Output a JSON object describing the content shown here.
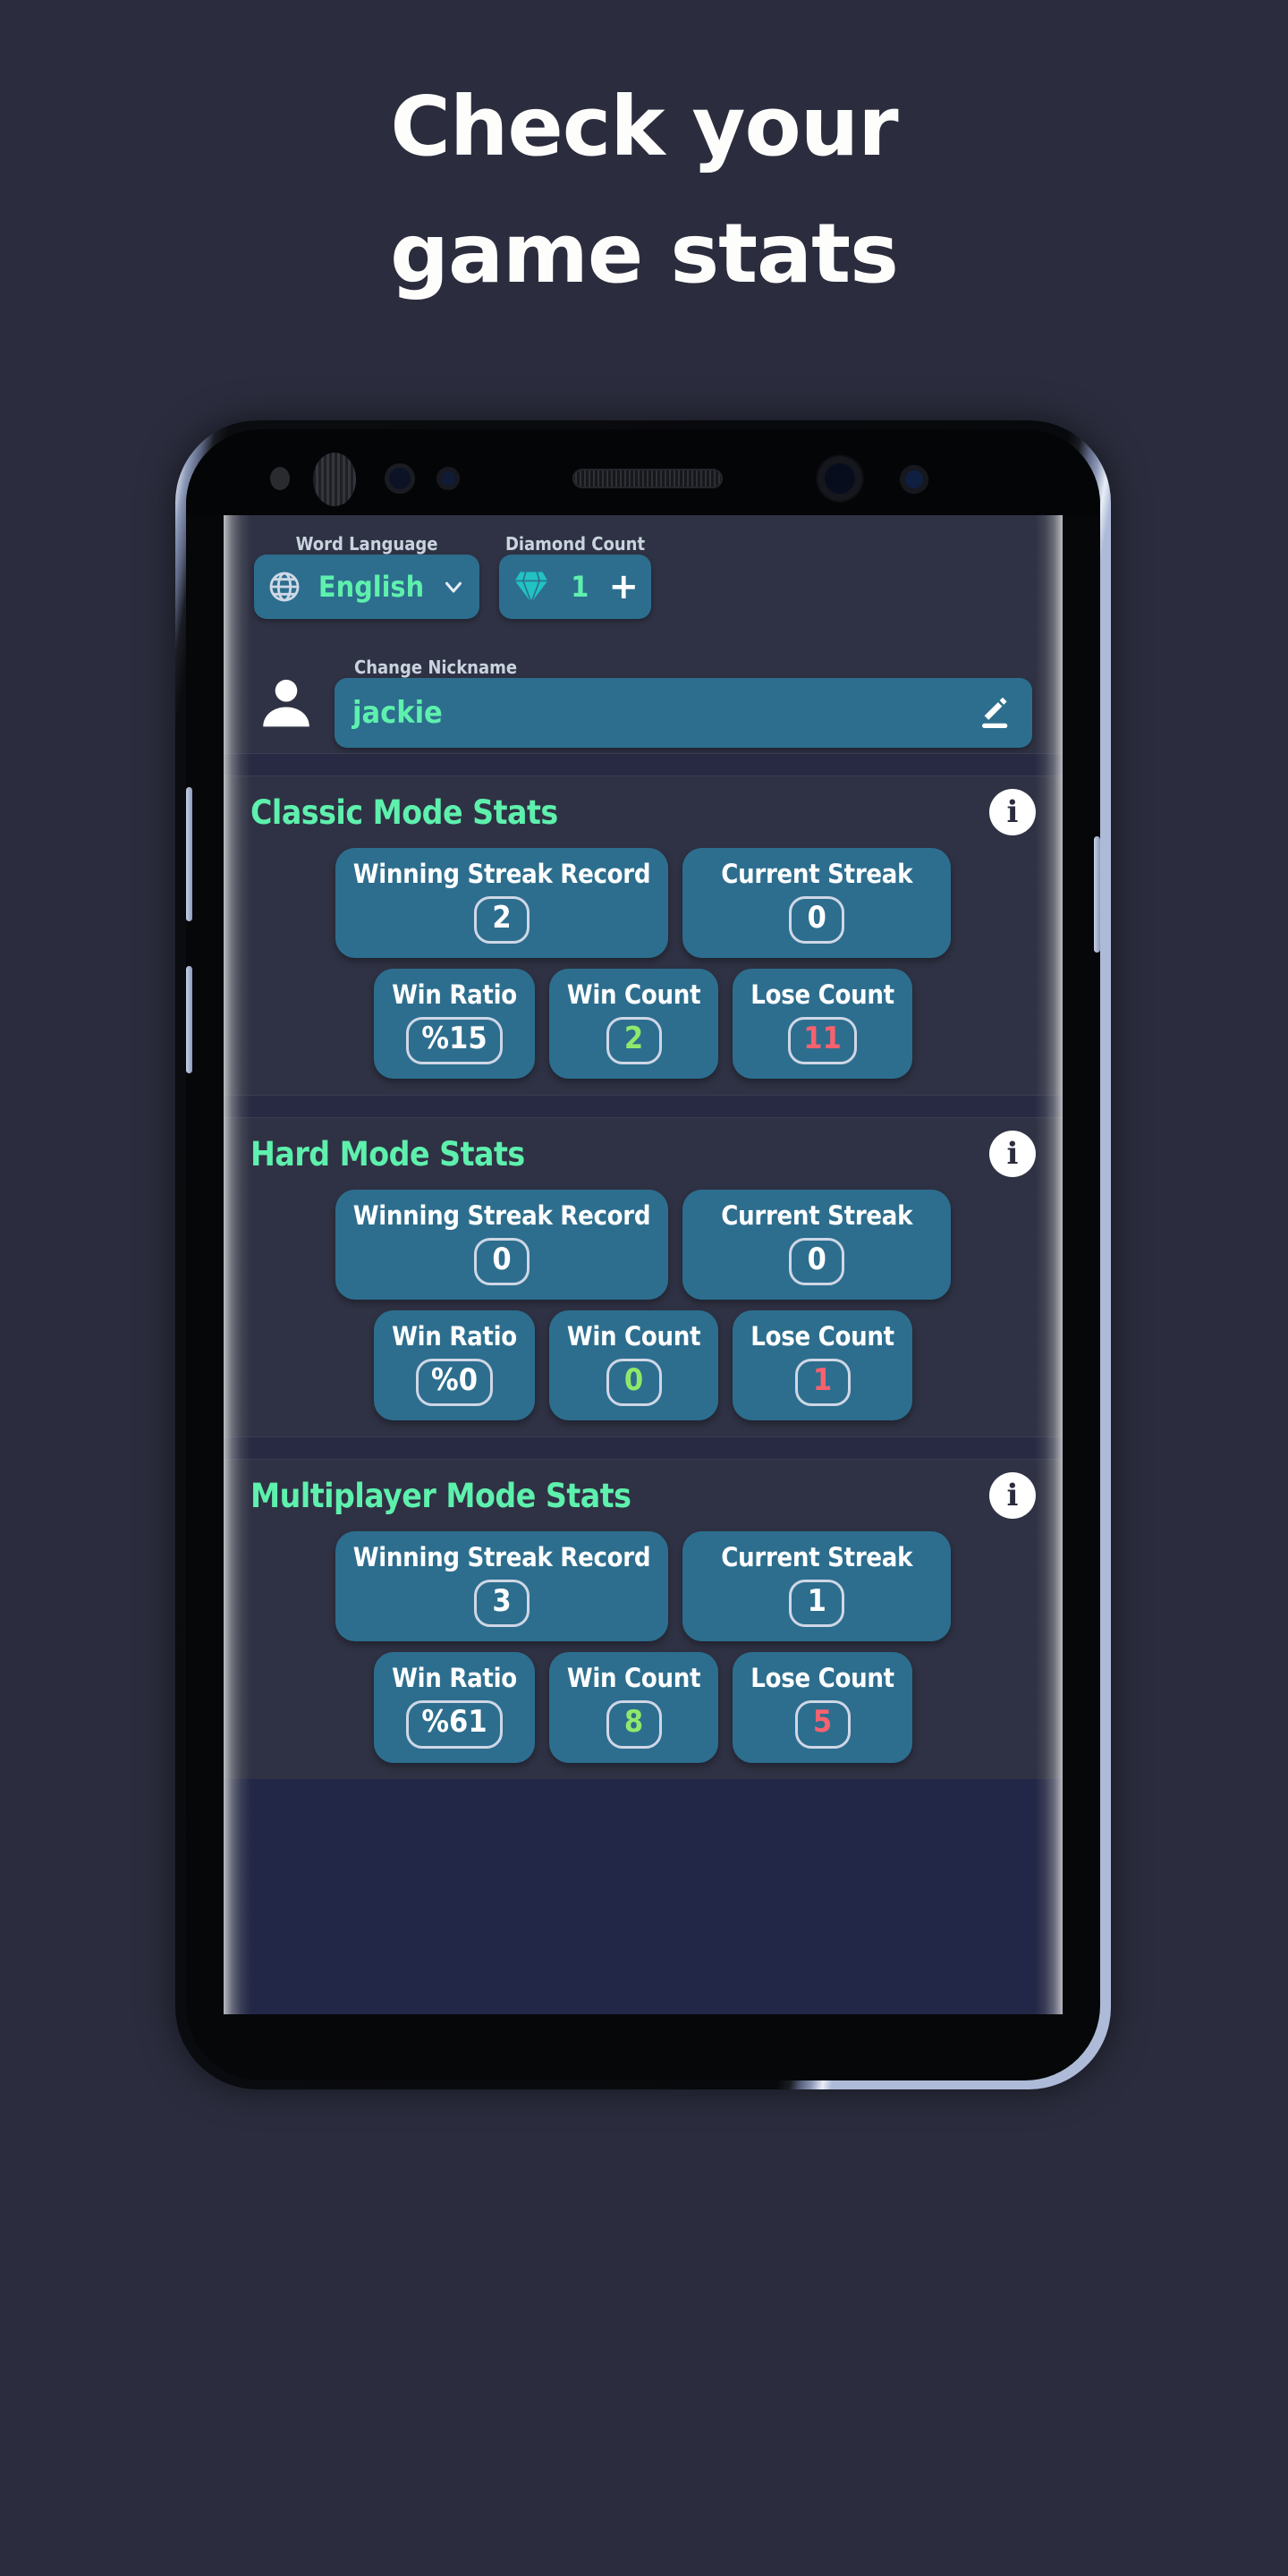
{
  "headline": {
    "line1": "Check your",
    "line2": "game stats"
  },
  "settings": {
    "language": {
      "label": "Word Language",
      "value": "English",
      "icon": "globe-icon",
      "chevron": "chevron-down-icon"
    },
    "diamond": {
      "label": "Diamond Count",
      "value": "1",
      "add": "+",
      "icon": "diamond-icon"
    },
    "nickname": {
      "label": "Change Nickname",
      "value": "jackie",
      "avatar_icon": "person-icon",
      "edit_icon": "pencil-icon"
    }
  },
  "info_icon_label": "i",
  "sections": [
    {
      "title": "Classic Mode Stats",
      "row1": [
        {
          "label": "Winning Streak Record",
          "value": "2",
          "color": "white"
        },
        {
          "label": "Current Streak",
          "value": "0",
          "color": "white"
        }
      ],
      "row2": [
        {
          "label": "Win Ratio",
          "value": "%15",
          "color": "white"
        },
        {
          "label": "Win Count",
          "value": "2",
          "color": "green"
        },
        {
          "label": "Lose Count",
          "value": "11",
          "color": "red"
        }
      ]
    },
    {
      "title": "Hard Mode Stats",
      "row1": [
        {
          "label": "Winning Streak Record",
          "value": "0",
          "color": "white"
        },
        {
          "label": "Current Streak",
          "value": "0",
          "color": "white"
        }
      ],
      "row2": [
        {
          "label": "Win Ratio",
          "value": "%0",
          "color": "white"
        },
        {
          "label": "Win Count",
          "value": "0",
          "color": "green"
        },
        {
          "label": "Lose Count",
          "value": "1",
          "color": "red"
        }
      ]
    },
    {
      "title": "Multiplayer Mode Stats",
      "row1": [
        {
          "label": "Winning Streak Record",
          "value": "3",
          "color": "white"
        },
        {
          "label": "Current Streak",
          "value": "1",
          "color": "white"
        }
      ],
      "row2": [
        {
          "label": "Win Ratio",
          "value": "%61",
          "color": "white"
        },
        {
          "label": "Win Count",
          "value": "8",
          "color": "green"
        },
        {
          "label": "Lose Count",
          "value": "5",
          "color": "red"
        }
      ]
    }
  ],
  "colors": {
    "page_bg": "#2b2d3e",
    "screen_bg": "#2f3244",
    "card_blue": "#2d6e8e",
    "accent_green": "#5ef0ad",
    "value_green": "#90e86b",
    "value_red": "#f8616e",
    "diamond_cyan": "#22c6c6",
    "label_grey": "#c9d3de",
    "divider": "#272a42",
    "bottom_fill": "#232747"
  }
}
